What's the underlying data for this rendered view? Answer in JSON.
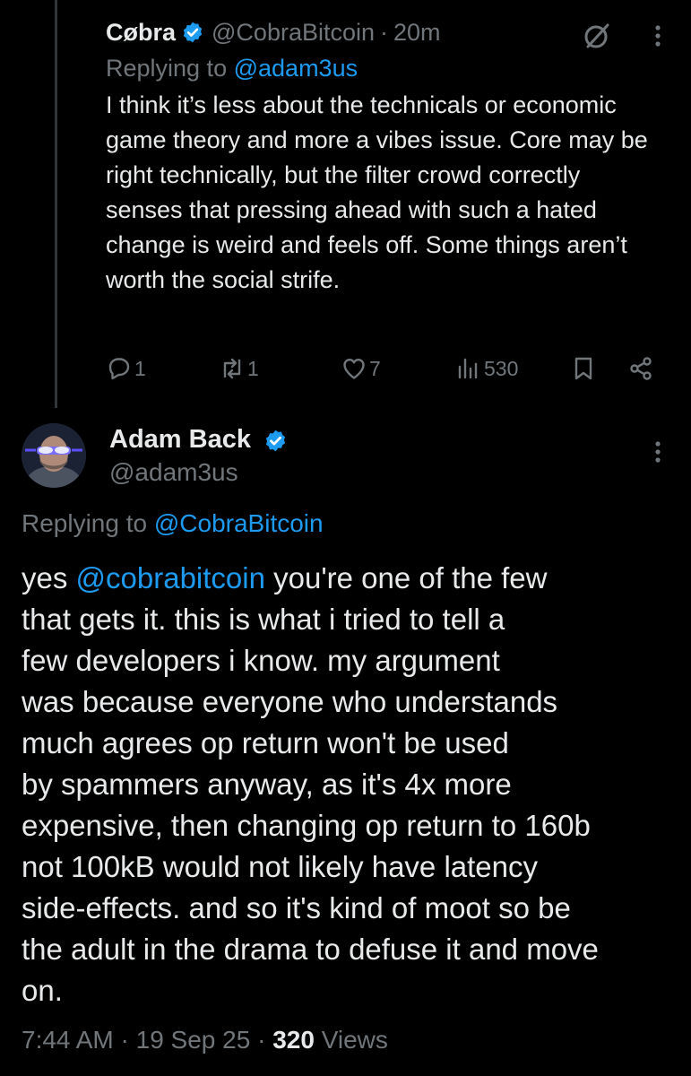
{
  "reply_tweet": {
    "display_name": "Cøbra",
    "handle": "@CobraBitcoin",
    "separator": "·",
    "time_ago": "20m",
    "replying_to_prefix": "Replying to",
    "replying_to_handle": "@adam3us",
    "text": "I think it’s less about the technicals or economic game theory and more a vibes issue. Core may be right technically, but the filter crowd correctly senses that pressing ahead with such a hated change is weird and feels off. Some things aren’t worth the social strife.",
    "actions": {
      "reply_count": "1",
      "repost_count": "1",
      "like_count": "7",
      "views_count": "530"
    }
  },
  "main_tweet": {
    "display_name": "Adam Back",
    "handle": "@adam3us",
    "replying_to_prefix": "Replying to",
    "replying_to_handle": "@CobraBitcoin",
    "lines": [
      "that gets it. this is what i tried to tell a",
      "few developers i know. my argument",
      "was because everyone who understands",
      "much agrees op return won't be used",
      "by spammers anyway, as it's 4x more",
      "expensive, then changing op return to 160b",
      "not 100kB would not likely have latency",
      "side-effects. and so it's kind of moot so be",
      "the adult in the drama to defuse it and move",
      "on."
    ],
    "first_line_prefix": "yes",
    "first_line_mention": "@cobrabitcoin",
    "first_line_suffix": "you're one of the few",
    "timestamp": "7:44 AM",
    "date": "19 Sep 25",
    "separator": "·",
    "views_count": "320",
    "views_label": "Views"
  },
  "colors": {
    "background": "#000000",
    "text": "#e7e9ea",
    "muted": "#71767b",
    "accent": "#1d9bf0",
    "thread_line": "#333639"
  },
  "icons": [
    "verified-badge-icon",
    "grok-icon",
    "more-icon",
    "reply-icon",
    "repost-icon",
    "like-icon",
    "views-icon",
    "bookmark-icon",
    "share-icon"
  ]
}
